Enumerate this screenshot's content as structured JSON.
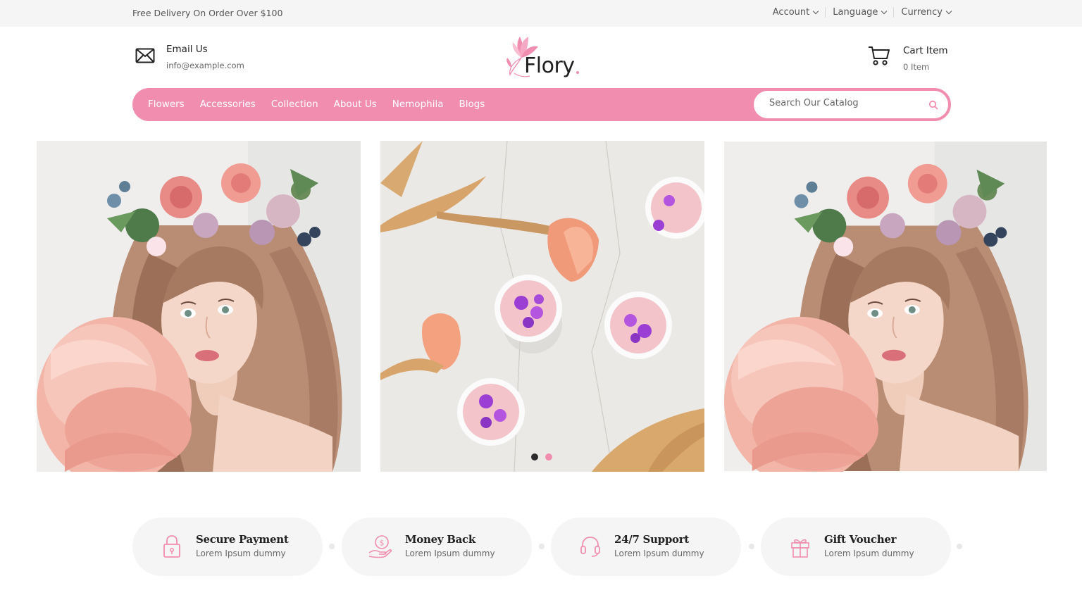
{
  "topbar": {
    "promo": "Free Delivery On Order Over $100",
    "menus": [
      "Account",
      "Language",
      "Currency"
    ]
  },
  "header": {
    "email": {
      "title": "Email Us",
      "value": "info@example.com",
      "icon": "envelope-icon"
    },
    "logo": {
      "text": "Flory"
    },
    "cart": {
      "title": "Cart Item",
      "count": "0 Item",
      "icon": "cart-icon"
    }
  },
  "nav": {
    "items": [
      "Flowers",
      "Accessories",
      "Collection",
      "About Us",
      "Nemophila",
      "Blogs"
    ]
  },
  "search": {
    "placeholder": "Search Our Catalog",
    "icon": "search-icon"
  },
  "slider": {
    "panels": [
      "flower-crown-portrait",
      "tulips-and-petal-bowls",
      "flower-crown-portrait"
    ],
    "dots": 2,
    "active_dot": 0
  },
  "features": [
    {
      "title": "Secure Payment",
      "desc": "Lorem Ipsum dummy",
      "icon": "lock-icon"
    },
    {
      "title": "Money Back",
      "desc": "Lorem Ipsum dummy",
      "icon": "money-hand-icon"
    },
    {
      "title": "24/7 Support",
      "desc": "Lorem Ipsum dummy",
      "icon": "headset-icon"
    },
    {
      "title": "Gift Voucher",
      "desc": "Lorem Ipsum dummy",
      "icon": "gift-icon"
    }
  ],
  "colors": {
    "accent": "#f18daf",
    "topbar_bg": "#f5f5f5",
    "feature_bg": "#f5f5f5",
    "dot_active": "#2b2b2b",
    "dot_inactive": "#f18daf"
  }
}
